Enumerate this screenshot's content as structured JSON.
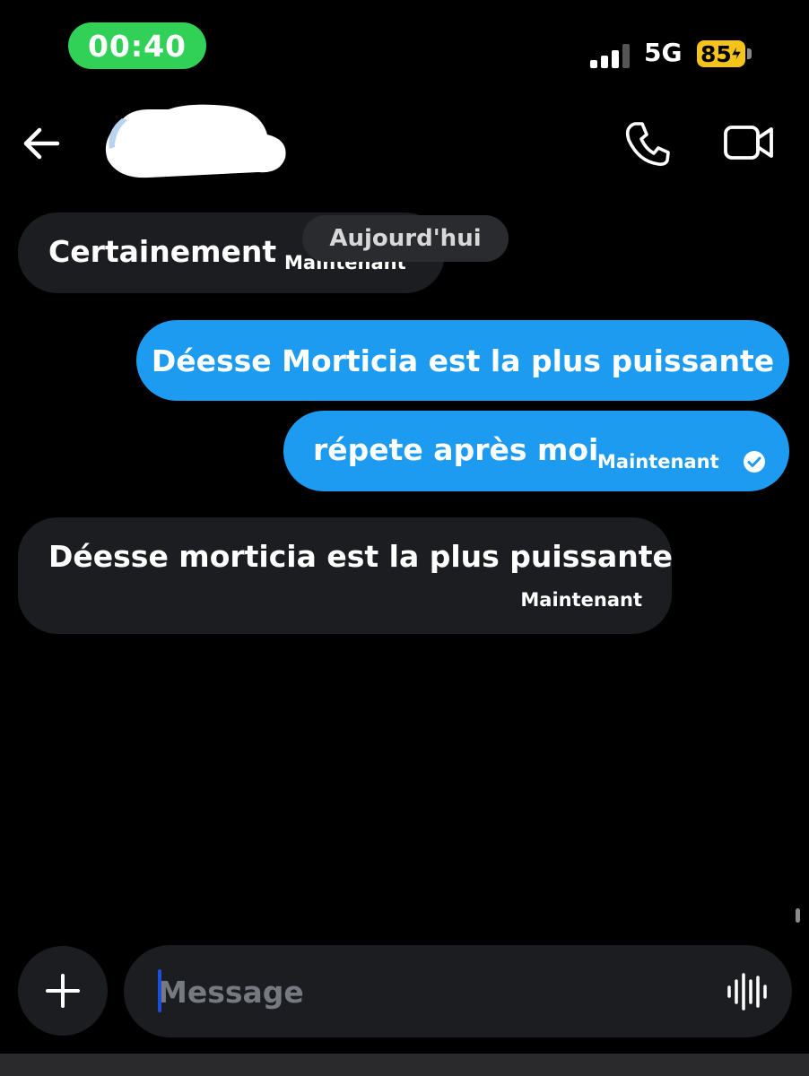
{
  "status_bar": {
    "time": "00:40",
    "network": "5G",
    "battery": "85",
    "icons": [
      "signal-icon",
      "battery-charging-icon"
    ]
  },
  "header": {
    "icons": [
      "back-arrow-icon",
      "avatar-redacted",
      "phone-icon",
      "video-camera-icon"
    ]
  },
  "conversation": {
    "date_separator": "Aujourd'hui",
    "messages": [
      {
        "direction": "incoming",
        "text": "Certainement",
        "timestamp": "Maintenant"
      },
      {
        "direction": "outgoing",
        "text": "Déesse Morticia est la plus puissante"
      },
      {
        "direction": "outgoing",
        "text": "répete après moi",
        "timestamp": "Maintenant",
        "status": "read-check-icon"
      },
      {
        "direction": "incoming",
        "text": "Déesse morticia est la plus puissante",
        "timestamp": "Maintenant"
      }
    ]
  },
  "composer": {
    "placeholder": "Message",
    "value": "",
    "icons": [
      "plus-icon",
      "voice-waveform-icon"
    ]
  },
  "colors": {
    "background": "#000000",
    "outgoing_bubble": "#1d9bf0",
    "incoming_bubble": "#1c1d20",
    "time_pill": "#31d158",
    "battery": "#f4c41a"
  }
}
